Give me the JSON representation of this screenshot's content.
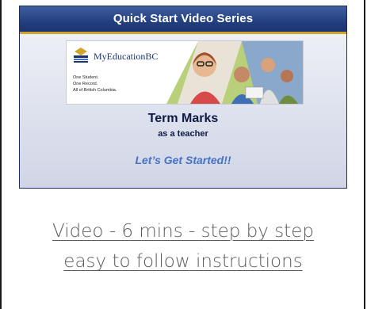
{
  "thumbnail": {
    "banner_title": "Quick Start Video Series",
    "brand": "MyEducationBC",
    "tagline": [
      "One Student.",
      "One Record.",
      "All of British Columbia."
    ],
    "title": "Term Marks",
    "subtitle": "as a teacher",
    "cta": "Let’s Get Started!!"
  },
  "link": {
    "line1": "Video - 6 mins - step by step",
    "line2": "easy to follow instructions"
  },
  "colors": {
    "banner": "#243f7e",
    "banner_stripe": "#d3a42a",
    "cta": "#4572c4",
    "link": "#5c5c5c"
  }
}
